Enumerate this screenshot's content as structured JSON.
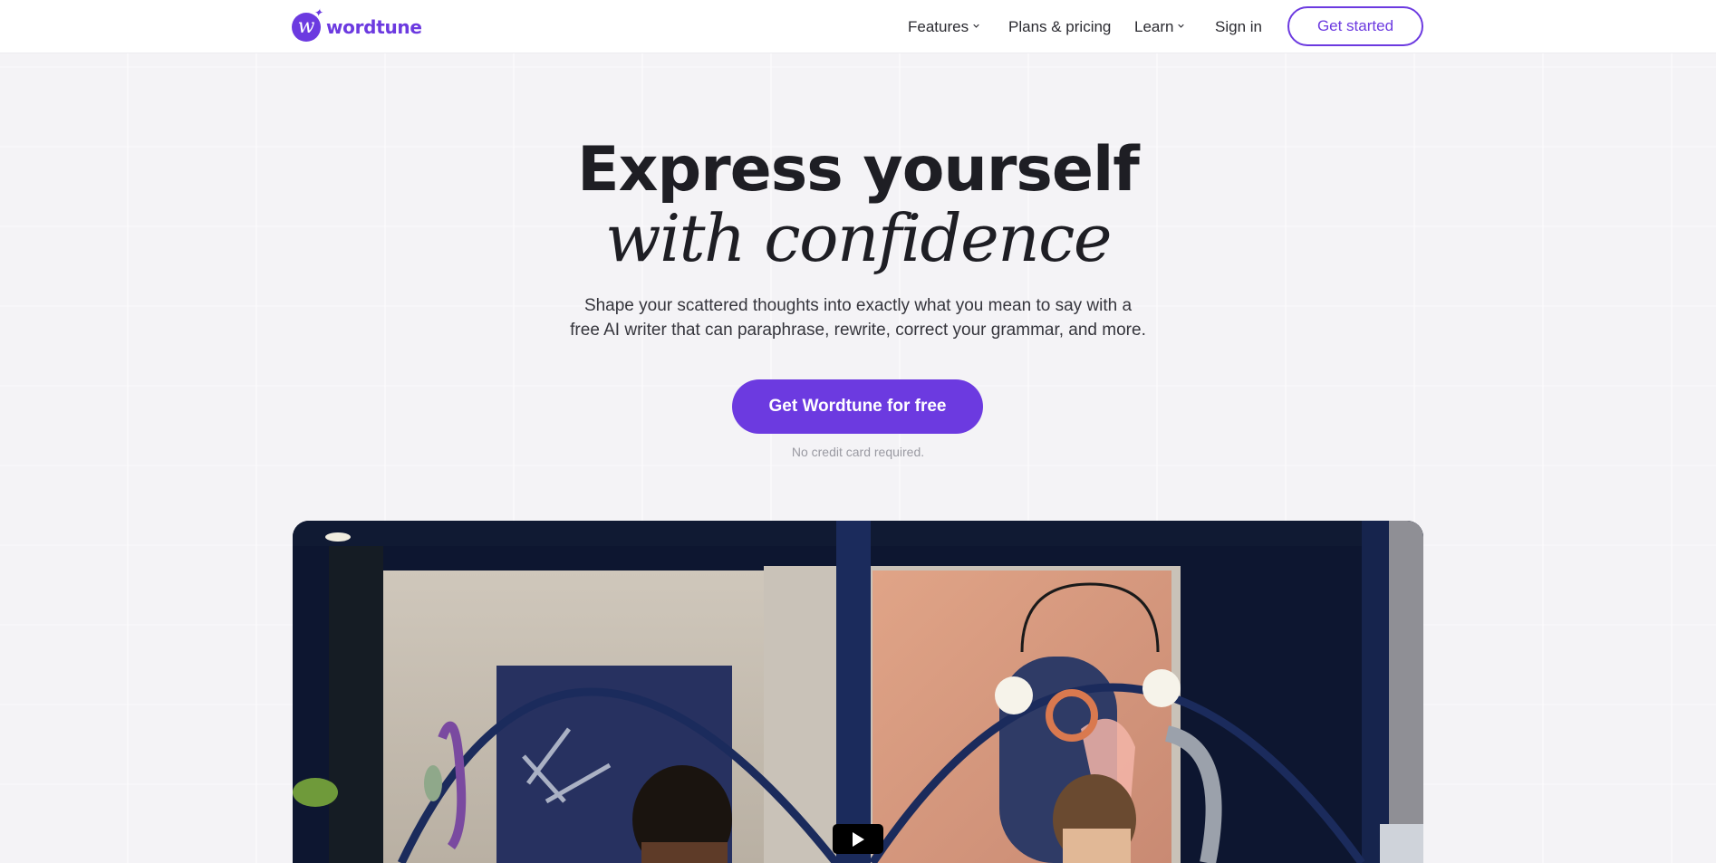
{
  "brand": {
    "name": "wordtune",
    "accent": "#6c3ae0"
  },
  "nav": {
    "features": "Features",
    "plans": "Plans & pricing",
    "learn": "Learn",
    "signin": "Sign in",
    "get_started": "Get started"
  },
  "hero": {
    "title_line1": "Express yourself",
    "title_line2": "with confidence",
    "subtitle_line1": "Shape your scattered thoughts into exactly what you mean to say with a",
    "subtitle_line2": "free AI writer that can paraphrase, rewrite, correct your grammar, and more.",
    "cta_label": "Get Wordtune for free",
    "cta_note": "No credit card required."
  },
  "icons": {
    "chevron": "chevron-down-icon",
    "play": "play-icon",
    "logo": "wordtune-logo-icon"
  }
}
